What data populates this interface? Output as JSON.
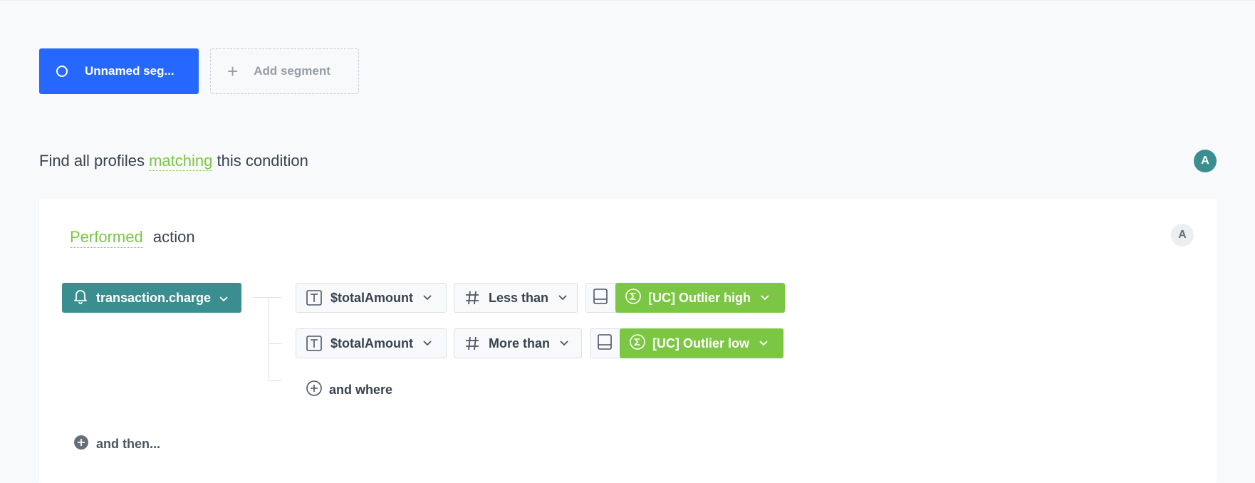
{
  "segments": {
    "active_label": "Unnamed seg...",
    "add_label": "Add segment"
  },
  "condition": {
    "prefix": "Find all profiles",
    "keyword": "matching",
    "suffix": "this condition",
    "badge": "A"
  },
  "step": {
    "keyword": "Performed",
    "label": "action",
    "badge": "A",
    "event": "transaction.charge",
    "filters": [
      {
        "param": "$totalAmount",
        "operator": "Less than",
        "value": "[UC] Outlier high"
      },
      {
        "param": "$totalAmount",
        "operator": "More than",
        "value": "[UC] Outlier low"
      }
    ],
    "and_where": "and where",
    "and_then": "and then..."
  },
  "colors": {
    "primary": "#2668ff",
    "teal": "#3b8e8f",
    "green": "#7bc743",
    "text": "#384350"
  }
}
